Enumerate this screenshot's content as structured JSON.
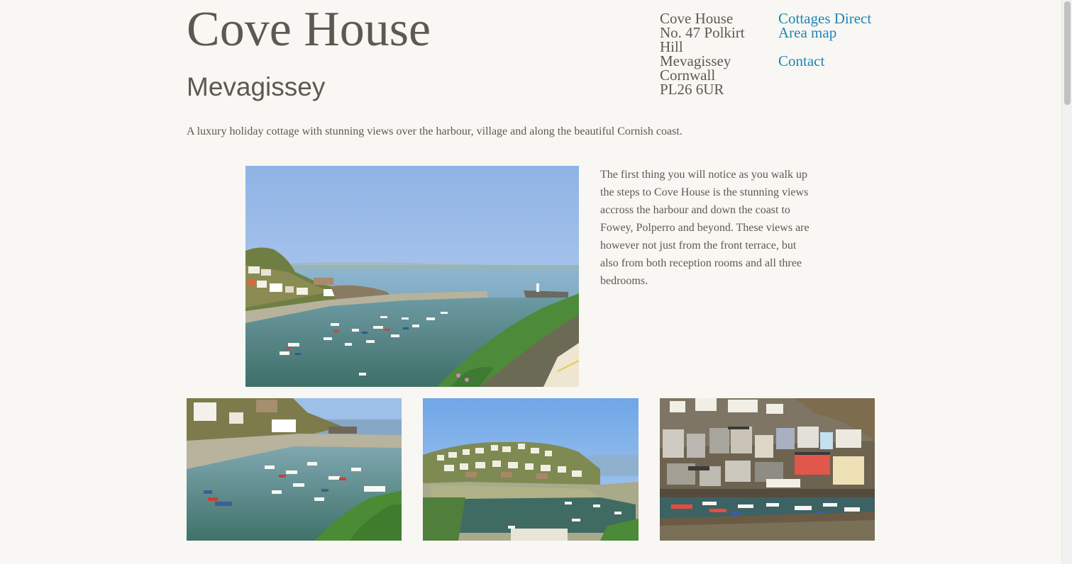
{
  "header": {
    "title": "Cove House",
    "subtitle": "Mevagissey"
  },
  "address": {
    "lines": [
      "Cove House",
      "No. 47 Polkirt",
      "Hill",
      "Mevagissey",
      "Cornwall",
      "PL26 6UR"
    ]
  },
  "nav": {
    "items": [
      {
        "label": "Cottages Direct"
      },
      {
        "label": "Area map"
      },
      {
        "label": "Contact"
      }
    ],
    "link_color": "#1e87b6"
  },
  "intro": "A luxury holiday cottage with stunning views over the harbour, village and along the beautiful Cornish coast.",
  "description": "The first thing you will notice as you walk up the steps to Cove House is the stunning views accross the harbour and down the coast to Fowey, Polperro and beyond. These views are however not just from the front terrace, but also from both reception rooms and all three bedrooms.",
  "colors": {
    "background": "#f8f7f3",
    "text": "#5f5850",
    "link": "#1e87b6"
  }
}
